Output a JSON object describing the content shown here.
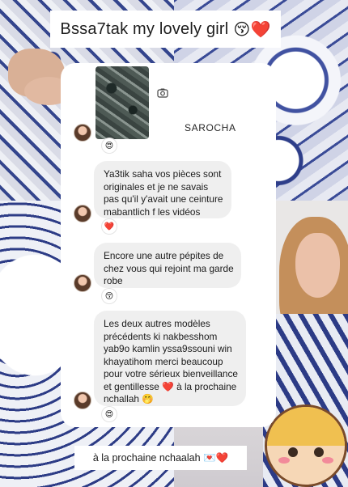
{
  "title": "Bssa7tak my lovely girl",
  "title_emojis": "😚❤️",
  "username": "SAROCHA",
  "post_reaction": "😍",
  "messages": [
    {
      "lines": [
        "Ya3tik saha vos pièces sont",
        "originales et je ne savais",
        "pas qu'il y'avait une ceinture",
        "mabantlich f les vidéos"
      ],
      "reaction": "❤️"
    },
    {
      "lines": [
        "Encore une autre pépites de",
        "chez vous qui rejoint ma garde",
        "robe"
      ],
      "reaction": "😚"
    },
    {
      "lines": [
        "Les deux autres modèles",
        "précédents ki nakbesshom",
        "yab9o kamlin yssa9ssouni win",
        "khayatihom merci beaucoup",
        "pour votre sérieux bienveillance",
        "et gentillesse ❤️ à la prochaine",
        "nchallah 🤭"
      ],
      "reaction": "😍"
    }
  ],
  "footer": "à la prochaine nchaalah 💌❤️",
  "icons": {
    "camera": "camera-icon",
    "avatar": "user-avatar"
  },
  "colors": {
    "bubble": "#efefef",
    "card": "#ffffff",
    "text": "#1b1b1b",
    "accent_blue": "#2f3f86"
  }
}
